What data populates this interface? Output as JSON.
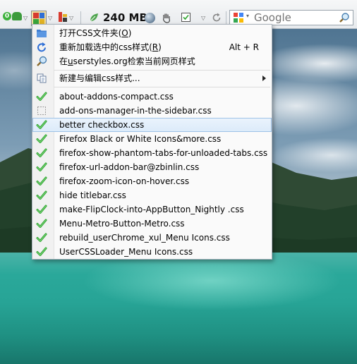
{
  "toolbar": {
    "badge_count": "0",
    "memory": "240 MB",
    "search": {
      "placeholder": "Google",
      "engine_icon": "google-icon"
    }
  },
  "menu": {
    "top_items": [
      {
        "label_pre": "打开CSS文件夹(",
        "mnemonic": "O",
        "label_post": ")",
        "accel": "",
        "icon": "folder-icon"
      },
      {
        "label_pre": "重新加载选中的css样式(",
        "mnemonic": "R",
        "label_post": ")",
        "accel": "Alt + R",
        "icon": "reload-icon"
      },
      {
        "label_pre": "在",
        "mnemonic": "u",
        "label_post": "serstyles.org检索当前网页样式",
        "accel": "",
        "icon": "search-icon"
      }
    ],
    "new_edit": {
      "label": "新建与编辑css样式...",
      "icon": "copy-icon"
    },
    "styles": [
      {
        "label": "about-addons-compact.css",
        "checked": true
      },
      {
        "label": "add-ons-manager-in-the-sidebar.css",
        "checked": false
      },
      {
        "label": "better checkbox.css",
        "checked": true,
        "highlighted": true
      },
      {
        "label": "Firefox Black or White Icons&more.css",
        "checked": true
      },
      {
        "label": "firefox-show-phantom-tabs-for-unloaded-tabs.css",
        "checked": true
      },
      {
        "label": "firefox-url-addon-bar@zbinlin.css",
        "checked": true
      },
      {
        "label": "firefox-zoom-icon-on-hover.css",
        "checked": true
      },
      {
        "label": "hide titlebar.css",
        "checked": true
      },
      {
        "label": "make-FlipClock-into-AppButton_Nightly .css",
        "checked": true
      },
      {
        "label": "Menu-Metro-Button-Metro.css",
        "checked": true
      },
      {
        "label": "rebuild_userChrome_xul_Menu Icons.css",
        "checked": true
      },
      {
        "label": "UserCSSLoader_Menu Icons.css",
        "checked": true
      }
    ]
  },
  "colors": {
    "highlight_border": "#9ec2e6",
    "highlight_bg": "#dcebfa",
    "check_green": "#2fa52f",
    "lake": "#27a496"
  }
}
